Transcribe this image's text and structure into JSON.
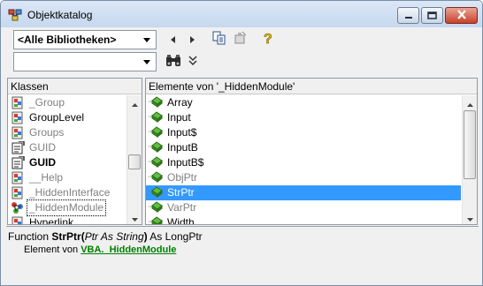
{
  "window": {
    "title": "Objektkatalog",
    "icon": "object-browser-icon",
    "controls": [
      "minimize",
      "maximize",
      "close"
    ]
  },
  "toolbar": {
    "library_combo": {
      "value": "<Alle Bibliotheken>"
    },
    "search_combo": {
      "value": ""
    },
    "buttons": [
      {
        "name": "back-icon",
        "glyph": "◂"
      },
      {
        "name": "forward-icon",
        "glyph": "▸"
      },
      {
        "name": "copy-to-clipboard-icon"
      },
      {
        "name": "view-definition-icon"
      },
      {
        "name": "help-icon",
        "glyph": "?"
      },
      {
        "name": "search-icon"
      },
      {
        "name": "toggle-search-results-icon",
        "glyph": "⌄"
      }
    ]
  },
  "classes": {
    "header": "Klassen",
    "items": [
      {
        "label": "_Group",
        "icon": "class-icon",
        "style": "gray"
      },
      {
        "label": "GroupLevel",
        "icon": "class-icon",
        "style": "normal"
      },
      {
        "label": "Groups",
        "icon": "class-icon",
        "style": "gray"
      },
      {
        "label": "GUID",
        "icon": "user-type-icon",
        "style": "gray"
      },
      {
        "label": "GUID",
        "icon": "user-type-icon",
        "style": "bold"
      },
      {
        "label": "__Help",
        "icon": "class-icon",
        "style": "gray"
      },
      {
        "label": "_HiddenInterface",
        "icon": "class-icon",
        "style": "gray"
      },
      {
        "label": "_HiddenModule",
        "icon": "module-icon",
        "style": "gray",
        "focused": true
      },
      {
        "label": "Hyperlink",
        "icon": "class-icon",
        "style": "normal"
      }
    ]
  },
  "members": {
    "header": "Elemente von '_HiddenModule'",
    "items": [
      {
        "label": "Array",
        "icon": "method-icon",
        "style": "normal"
      },
      {
        "label": "Input",
        "icon": "method-icon",
        "style": "normal"
      },
      {
        "label": "Input$",
        "icon": "method-icon",
        "style": "normal"
      },
      {
        "label": "InputB",
        "icon": "method-icon",
        "style": "normal"
      },
      {
        "label": "InputB$",
        "icon": "method-icon",
        "style": "normal"
      },
      {
        "label": "ObjPtr",
        "icon": "method-icon",
        "style": "gray"
      },
      {
        "label": "StrPtr",
        "icon": "method-icon",
        "style": "gray",
        "selected": true
      },
      {
        "label": "VarPtr",
        "icon": "method-icon",
        "style": "gray"
      },
      {
        "label": "Width",
        "icon": "method-icon",
        "style": "normal"
      }
    ]
  },
  "details": {
    "signature": {
      "keyword": "Function ",
      "name": "StrPtr",
      "open": "(",
      "param": "Ptr As String",
      "close": ")",
      "returns": " As LongPtr"
    },
    "member_of_label": "Element von ",
    "member_of_link": "VBA._HiddenModule"
  },
  "colors": {
    "selection": "#3399ff",
    "link": "#008000",
    "gray_text": "#808080"
  }
}
